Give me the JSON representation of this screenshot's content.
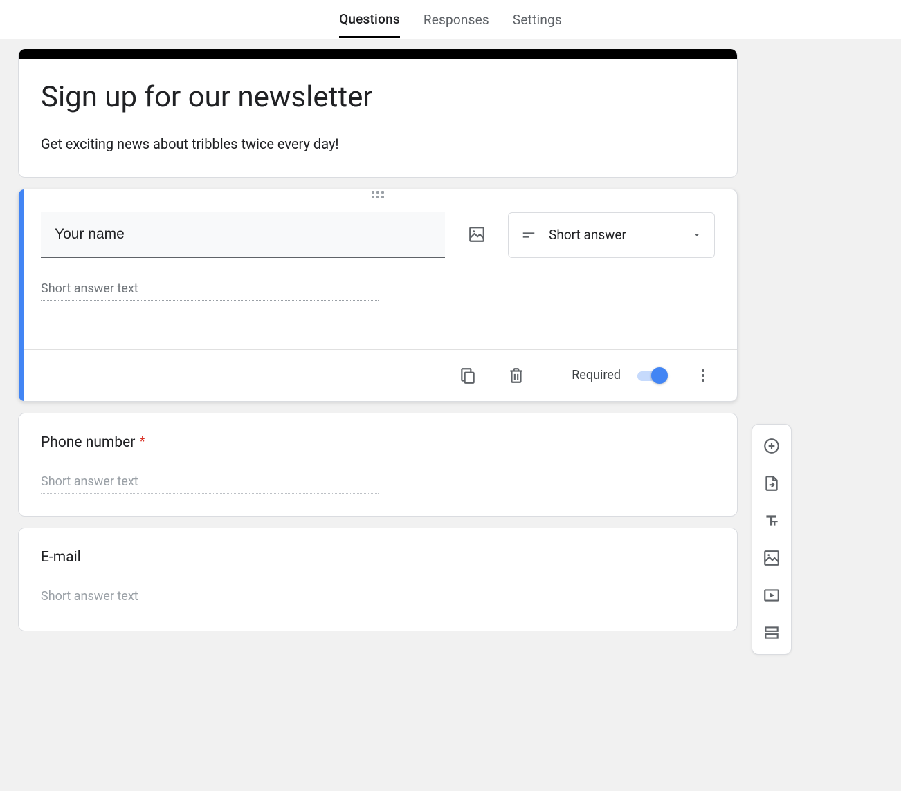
{
  "tabs": {
    "questions": "Questions",
    "responses": "Responses",
    "settings": "Settings"
  },
  "header": {
    "title": "Sign up for our newsletter",
    "description": "Get exciting news about tribbles twice every day!"
  },
  "active_question": {
    "title": "Your name",
    "type_label": "Short answer",
    "answer_placeholder": "Short answer text",
    "footer": {
      "required_label": "Required",
      "required_on": true
    }
  },
  "questions": [
    {
      "title": "Phone number",
      "required": true,
      "answer_placeholder": "Short answer text"
    },
    {
      "title": "E-mail",
      "required": false,
      "answer_placeholder": "Short answer text"
    }
  ],
  "side_toolbar": {
    "add_question": "Add question",
    "import_questions": "Import questions",
    "add_title": "Add title and description",
    "add_image": "Add image",
    "add_video": "Add video",
    "add_section": "Add section"
  }
}
